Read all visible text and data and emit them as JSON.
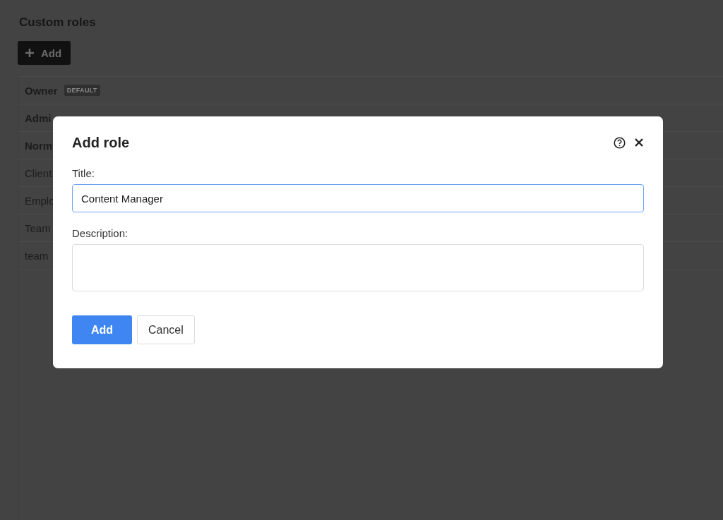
{
  "page": {
    "heading": "Custom roles",
    "add_button": "Add"
  },
  "roles": [
    {
      "name": "Owner",
      "bold": true,
      "badge": "DEFAULT"
    },
    {
      "name": "Admi",
      "bold": true
    },
    {
      "name": "Norm",
      "bold": true
    },
    {
      "name": "Client",
      "bold": false
    },
    {
      "name": "Emplo",
      "bold": false
    },
    {
      "name": "Team",
      "bold": false
    },
    {
      "name": "team",
      "bold": false
    }
  ],
  "dialog": {
    "title": "Add role",
    "fields": [
      {
        "kind": "input",
        "label": "Title:",
        "value": "Content Manager",
        "focused": true
      },
      {
        "kind": "textarea",
        "label": "Description:",
        "focused": false
      }
    ],
    "buttons": [
      {
        "label": "Add",
        "kind": "primary"
      },
      {
        "label": "Cancel",
        "kind": "secondary"
      }
    ]
  }
}
